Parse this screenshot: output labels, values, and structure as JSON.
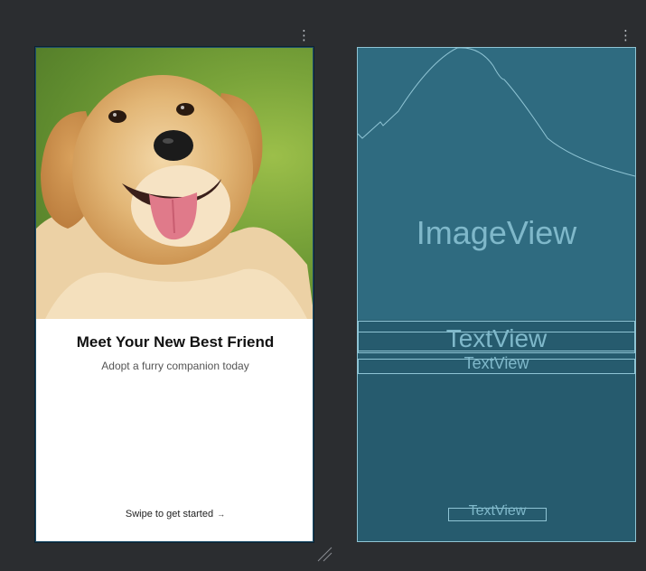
{
  "design": {
    "title": "Meet Your New Best Friend",
    "subtitle": "Adopt a furry companion today",
    "cta_label": "Swipe to get started",
    "cta_arrow": "→"
  },
  "blueprint": {
    "image_label": "ImageView",
    "title_label": "TextView",
    "subtitle_label": "TextView",
    "cta_label": "TextView"
  },
  "icons": {
    "menu": "more-vert-icon",
    "resize": "resize-handle-icon",
    "dots": "⋮"
  },
  "colors": {
    "canvas_bg": "#2b2d30",
    "blueprint_bg": "#265b6e",
    "blueprint_line": "#8fc4d4",
    "blueprint_text": "#7fb8ca"
  }
}
